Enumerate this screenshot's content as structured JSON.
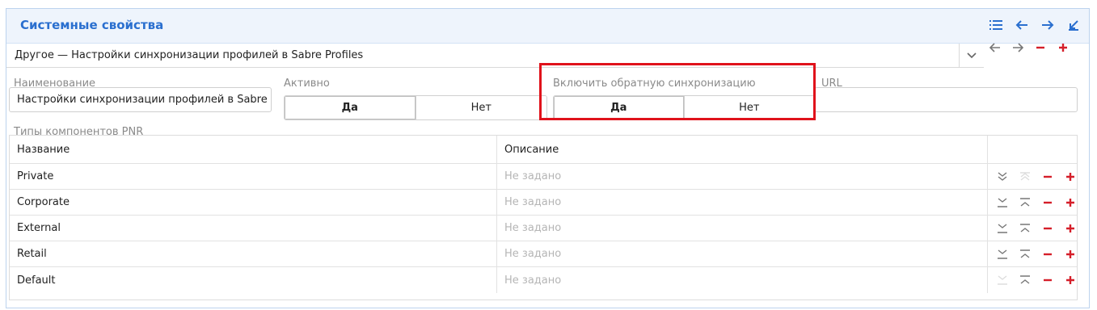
{
  "panel": {
    "title": "Системные свойства",
    "header_icons": [
      "list-icon",
      "arrow-left-icon",
      "arrow-right-icon",
      "collapse-icon"
    ]
  },
  "selector": {
    "value": "Другое — Настройки синхронизации профилей в Sabre Profiles"
  },
  "fields": {
    "name_label": "Наименование",
    "name_value": "Настройки синхронизации профилей в Sabre Profiles",
    "active_label": "Активно",
    "active_yes": "Да",
    "active_no": "Нет",
    "reverse_sync_label": "Включить обратную синхронизацию",
    "reverse_sync_yes": "Да",
    "reverse_sync_no": "Нет",
    "url_label": "URL",
    "url_value": ""
  },
  "pnr": {
    "label": "Типы компонентов PNR",
    "columns": [
      "Название",
      "Описание"
    ],
    "rows": [
      {
        "name": "Private",
        "description": "Не задано"
      },
      {
        "name": "Corporate",
        "description": "Не задано"
      },
      {
        "name": "External",
        "description": "Не задано"
      },
      {
        "name": "Retail",
        "description": "Не задано"
      },
      {
        "name": "Default",
        "description": "Не задано"
      }
    ]
  },
  "colors": {
    "accent": "#2a6fcf",
    "danger": "#d51f2a",
    "highlight": "#e0121b"
  }
}
